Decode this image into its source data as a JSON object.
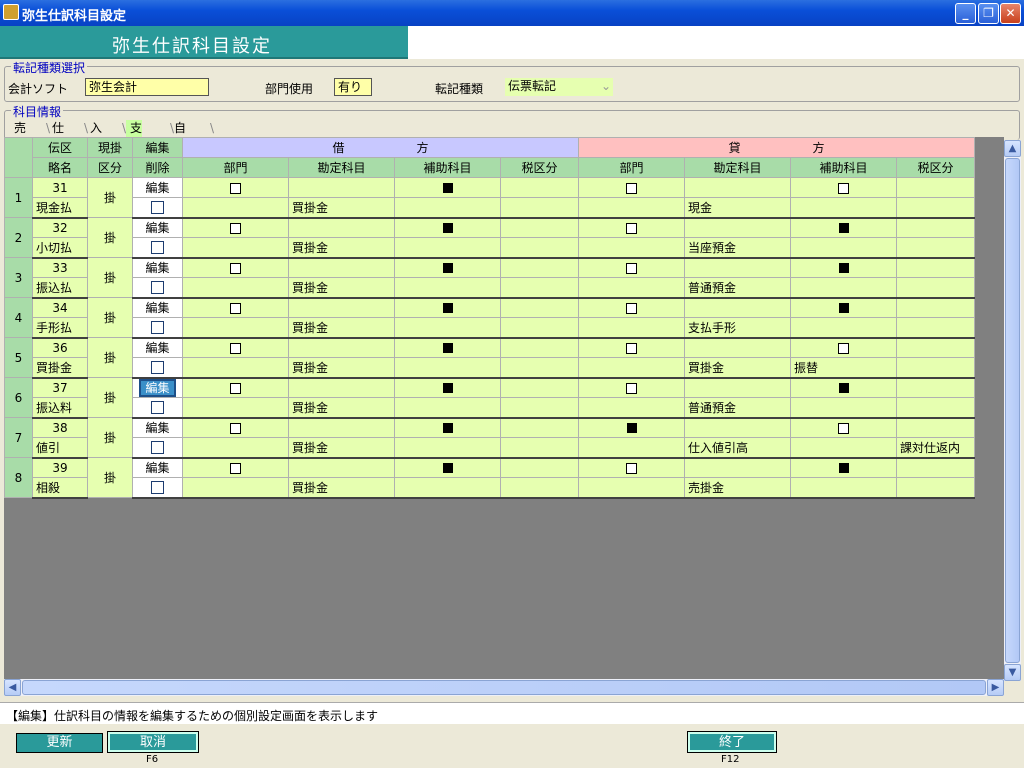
{
  "window": {
    "title": "弥生仕訳科目設定",
    "min": "_",
    "max": "❐",
    "close": "✕"
  },
  "header": {
    "title": "弥生仕訳科目設定"
  },
  "selection": {
    "legend": "転記種類選択",
    "soft_label": "会計ソフト",
    "soft_value": "弥生会計",
    "dept_label": "部門使用",
    "dept_value": "有り",
    "type_label": "転記種類",
    "type_value": "伝票転記"
  },
  "info": {
    "legend": "科目情報"
  },
  "tabs": [
    "売上",
    "仕入",
    "入金",
    "支払",
    "自動"
  ],
  "active_tab": "支払",
  "grid": {
    "h1": {
      "denku": "伝区",
      "genkake": "現掛",
      "henshu": "編集",
      "debit": "借　　　　　　方",
      "credit": "貸　　　　　　方"
    },
    "h2": {
      "ryaku": "略名",
      "kubun": "区分",
      "sakujo": "削除",
      "cols": [
        "部門",
        "勘定科目",
        "補助科目",
        "税区分",
        "部門",
        "勘定科目",
        "補助科目",
        "税区分"
      ]
    },
    "rows": [
      {
        "n": "1",
        "code": "31",
        "name": "現金払",
        "kb": "掛",
        "edit": "編集",
        "sel": false,
        "dd": "□",
        "dh": "■",
        "cd": "□",
        "ch": "□",
        "dk": "買掛金",
        "dz": "",
        "ck": "現金",
        "chv": "",
        "cz": ""
      },
      {
        "n": "2",
        "code": "32",
        "name": "小切払",
        "kb": "掛",
        "edit": "編集",
        "sel": false,
        "dd": "□",
        "dh": "■",
        "cd": "□",
        "ch": "■",
        "dk": "買掛金",
        "dz": "",
        "ck": "当座預金",
        "chv": "",
        "cz": ""
      },
      {
        "n": "3",
        "code": "33",
        "name": "振込払",
        "kb": "掛",
        "edit": "編集",
        "sel": false,
        "dd": "□",
        "dh": "■",
        "cd": "□",
        "ch": "■",
        "dk": "買掛金",
        "dz": "",
        "ck": "普通預金",
        "chv": "",
        "cz": ""
      },
      {
        "n": "4",
        "code": "34",
        "name": "手形払",
        "kb": "掛",
        "edit": "編集",
        "sel": false,
        "dd": "□",
        "dh": "■",
        "cd": "□",
        "ch": "■",
        "dk": "買掛金",
        "dz": "",
        "ck": "支払手形",
        "chv": "",
        "cz": ""
      },
      {
        "n": "5",
        "code": "36",
        "name": "買掛金",
        "kb": "掛",
        "edit": "編集",
        "sel": false,
        "dd": "□",
        "dh": "■",
        "cd": "□",
        "ch": "□",
        "dk": "買掛金",
        "dz": "",
        "ck": "買掛金",
        "chv": "振替",
        "cz": ""
      },
      {
        "n": "6",
        "code": "37",
        "name": "振込料",
        "kb": "掛",
        "edit": "編集",
        "sel": true,
        "dd": "□",
        "dh": "■",
        "cd": "□",
        "ch": "■",
        "dk": "買掛金",
        "dz": "",
        "ck": "普通預金",
        "chv": "",
        "cz": ""
      },
      {
        "n": "7",
        "code": "38",
        "name": "値引",
        "kb": "掛",
        "edit": "編集",
        "sel": false,
        "dd": "□",
        "dh": "■",
        "cd": "■",
        "ch": "□",
        "dk": "買掛金",
        "dz": "",
        "ck": "仕入値引高",
        "chv": "",
        "cz": "課対仕返内"
      },
      {
        "n": "8",
        "code": "39",
        "name": "相殺",
        "kb": "掛",
        "edit": "編集",
        "sel": false,
        "dd": "□",
        "dh": "■",
        "cd": "□",
        "ch": "■",
        "dk": "買掛金",
        "dz": "",
        "ck": "売掛金",
        "chv": "",
        "cz": ""
      }
    ]
  },
  "status": {
    "text": "【編集】仕訳科目の情報を編集するための個別設定画面を表示します"
  },
  "footer": {
    "update": "更新",
    "cancel": "取消",
    "cancel_key": "F6",
    "exit": "終了",
    "exit_key": "F12"
  }
}
